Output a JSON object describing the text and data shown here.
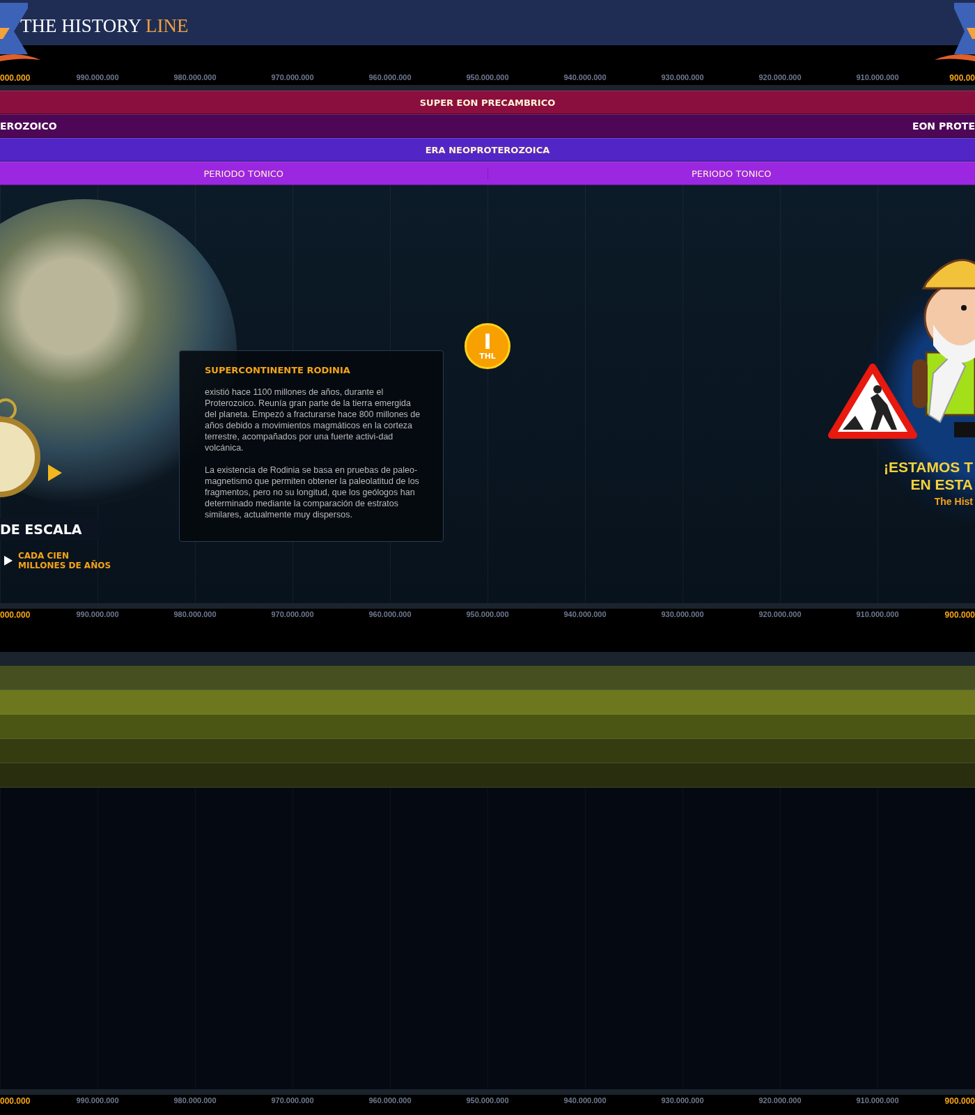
{
  "header": {
    "logo_main": "THE HISTORY",
    "logo_accent": "LINE"
  },
  "top_ruler": {
    "labels": [
      {
        "text": "000.000",
        "current": true
      },
      {
        "text": "990.000.000",
        "current": false
      },
      {
        "text": "980.000.000",
        "current": false
      },
      {
        "text": "970.000.000",
        "current": false
      },
      {
        "text": "960.000.000",
        "current": false
      },
      {
        "text": "950.000.000",
        "current": false
      },
      {
        "text": "940.000.000",
        "current": false
      },
      {
        "text": "930.000.000",
        "current": false
      },
      {
        "text": "920.000.000",
        "current": false
      },
      {
        "text": "910.000.000",
        "current": false
      },
      {
        "text": "900.00",
        "current": true
      }
    ]
  },
  "bands": [
    {
      "kind": "super-eon",
      "color": "#8a0f3e",
      "segments": [
        {
          "label": "SUPER EON PRECAMBRICO"
        }
      ]
    },
    {
      "kind": "eon",
      "color": "#4e0656",
      "segments": [
        {
          "label": "EROZOICO"
        },
        {
          "label": "EON PROTE"
        }
      ]
    },
    {
      "kind": "era",
      "color": "#5226c6",
      "segments": [
        {
          "label": "ERA NEOPROTEROZOICA"
        }
      ]
    },
    {
      "kind": "period",
      "color": "#9b27e0",
      "segments": [
        {
          "label": "PERIODO TONICO"
        },
        {
          "label": "PERIODO TONICO"
        }
      ]
    }
  ],
  "main": {
    "scale_title": "DE ESCALA",
    "scale_link": "CADA CIEN MILLONES DE AÑOS",
    "card": {
      "title": "SUPERCONTINENTE RODINIA",
      "paragraphs": [
        "existió hace 1100 millones de años, durante el Proterozoico. Reunía gran parte de la tierra emergida del planeta. Empezó a fracturarse hace 800 millones de años debido a movimientos magmáticos en la corteza terrestre, acompañados por una fuerte activi-dad volcánica.",
        "La existencia de Rodinia se basa en pruebas de paleo-magnetismo que permiten obtener la paleolatitud de los fragmentos, pero no su longitud, que los geólogos han determinado mediante la comparación de estratos similares, actualmente muy dispersos."
      ]
    },
    "marker": {
      "glyph": "I",
      "label": "THL"
    },
    "notice": {
      "line1": "¡ESTAMOS T",
      "line2": "EN ESTA",
      "line3": "The Hist"
    }
  },
  "middle_ruler": {
    "labels": [
      {
        "text": "000.000",
        "current": true
      },
      {
        "text": "990.000.000",
        "current": false
      },
      {
        "text": "980.000.000",
        "current": false
      },
      {
        "text": "970.000.000",
        "current": false
      },
      {
        "text": "960.000.000",
        "current": false
      },
      {
        "text": "950.000.000",
        "current": false
      },
      {
        "text": "940.000.000",
        "current": false
      },
      {
        "text": "930.000.000",
        "current": false
      },
      {
        "text": "920.000.000",
        "current": false
      },
      {
        "text": "910.000.000",
        "current": false
      },
      {
        "text": "900.000",
        "current": true
      }
    ]
  },
  "lower_bands": [
    {
      "color": "#464f20"
    },
    {
      "color": "#6c771e"
    },
    {
      "color": "#4b5514"
    },
    {
      "color": "#353d10"
    },
    {
      "color": "#282e0e"
    }
  ],
  "bottom_ruler": {
    "labels": [
      {
        "text": "000.000",
        "current": true
      },
      {
        "text": "990.000.000",
        "current": false
      },
      {
        "text": "980.000.000",
        "current": false
      },
      {
        "text": "970.000.000",
        "current": false
      },
      {
        "text": "960.000.000",
        "current": false
      },
      {
        "text": "950.000.000",
        "current": false
      },
      {
        "text": "940.000.000",
        "current": false
      },
      {
        "text": "930.000.000",
        "current": false
      },
      {
        "text": "920.000.000",
        "current": false
      },
      {
        "text": "910.000.000",
        "current": false
      },
      {
        "text": "900.000",
        "current": true
      }
    ]
  }
}
